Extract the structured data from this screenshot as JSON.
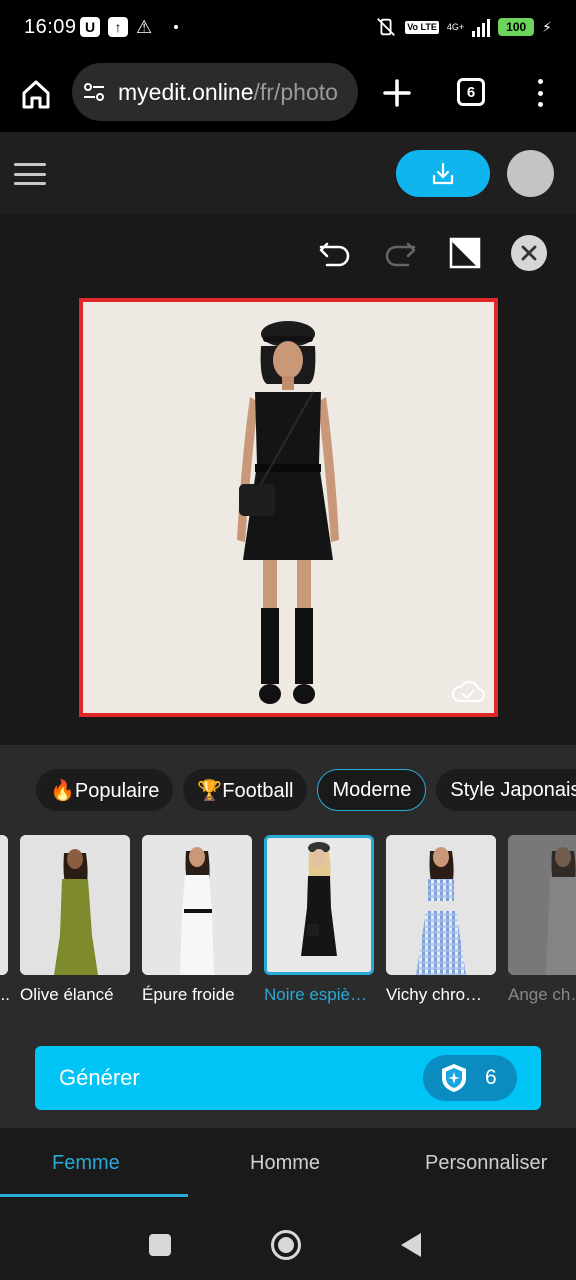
{
  "status_bar": {
    "time": "16:09",
    "battery": "100",
    "network": "4G+",
    "volte": "Vo LTE"
  },
  "browser": {
    "url_host": "myedit.online",
    "url_path": "/fr/photo",
    "tab_count": "6"
  },
  "editor": {
    "canvas_alt": "woman in black dress"
  },
  "style_chips": [
    {
      "label": "🔥Populaire"
    },
    {
      "label": "🏆Football"
    },
    {
      "label": "Moderne"
    },
    {
      "label": "Style Japonais"
    }
  ],
  "styles": [
    {
      "label": "..."
    },
    {
      "label": "Olive élancé"
    },
    {
      "label": "Épure froide"
    },
    {
      "label": "Noire espiè…"
    },
    {
      "label": "Vichy chro…"
    },
    {
      "label": "Ange ch…"
    }
  ],
  "generate": {
    "label": "Générer",
    "credits": "6"
  },
  "bottom_tabs": {
    "femme": "Femme",
    "homme": "Homme",
    "personnaliser": "Personnaliser"
  },
  "colors": {
    "accent": "#11b5ee",
    "generate": "#00c4f5",
    "selection": "#2aa8d8",
    "canvas_border": "#e0282a"
  }
}
